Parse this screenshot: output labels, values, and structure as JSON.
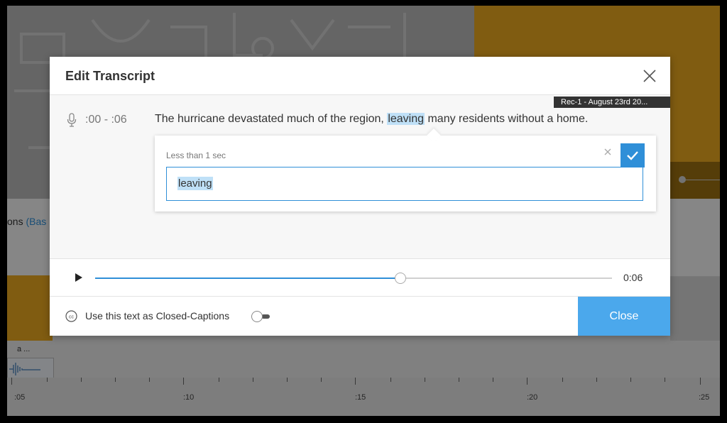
{
  "background": {
    "label_prefix": "ons",
    "label_link": "(Bas",
    "clip_label": "a ...",
    "ruler_labels": [
      ":05",
      ":10",
      ":15",
      ":20",
      ":25"
    ]
  },
  "modal": {
    "title": "Edit Transcript",
    "recording_tab": "Rec-1 - August 23rd 20...",
    "segment": {
      "time_range": ":00 - :06",
      "text_before": "The hurricane devastated much of the region, ",
      "highlighted_word": "leaving",
      "text_after": " many residents without a home."
    },
    "editor": {
      "duration_label": "Less than 1 sec",
      "input_value": "leaving"
    },
    "player": {
      "time": "0:06",
      "progress": 0.59
    },
    "footer": {
      "cc_text": "Use this text as Closed-Captions",
      "close_label": "Close"
    }
  },
  "colors": {
    "accent": "#2f8fd8",
    "close_button": "#4ba8ec",
    "highlight": "#bfe0f7",
    "gold": "#e9a820"
  },
  "icons": [
    "close-icon",
    "microphone-icon",
    "cancel-icon",
    "checkmark-icon",
    "play-icon",
    "closed-captions-icon"
  ]
}
